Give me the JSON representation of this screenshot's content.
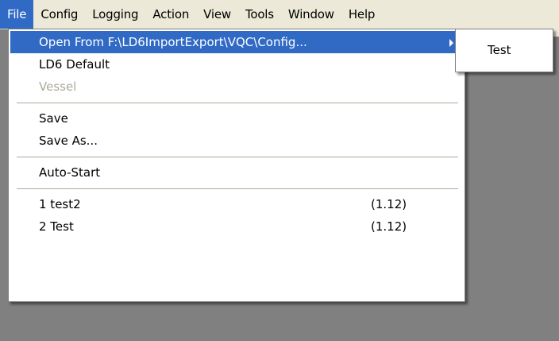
{
  "menubar": {
    "items": [
      "File",
      "Config",
      "Logging",
      "Action",
      "View",
      "Tools",
      "Window",
      "Help"
    ]
  },
  "file_menu": {
    "open_from": "Open From F:\\LD6ImportExport\\VQC\\Config...",
    "ld6_default": "LD6 Default",
    "vessel": "Vessel",
    "save": "Save",
    "save_as": "Save As...",
    "auto_start": "Auto-Start",
    "recent": [
      {
        "label": "1 test2",
        "version": "(1.12)"
      },
      {
        "label": "2 Test",
        "version": "(1.12)"
      }
    ]
  },
  "submenu": {
    "items": [
      "Test"
    ]
  },
  "colors": {
    "highlight": "#316ac5",
    "menubar": "#ece9d8",
    "background": "#808080",
    "disabled_text": "#aca899"
  }
}
